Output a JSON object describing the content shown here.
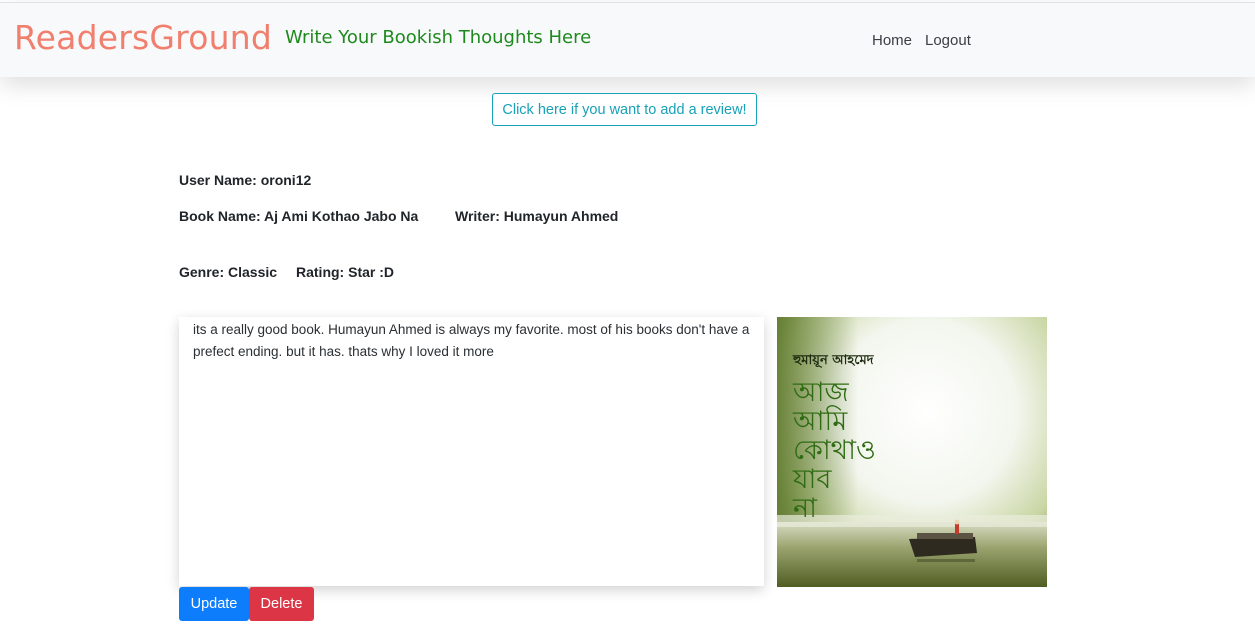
{
  "navbar": {
    "brand": "ReadersGround",
    "tagline": "Write Your Bookish Thoughts Here",
    "links": [
      "Home",
      "Logout"
    ]
  },
  "add_review_button": "Click here if you want to add a review!",
  "review": {
    "user_name": "User Name: oroni12",
    "book_name": "Book Name: Aj Ami Kothao Jabo Na",
    "writer": "Writer: Humayun Ahmed",
    "genre": "Genre: Classic",
    "rating": "Rating: Star :D",
    "text": "its a really good book. Humayun Ahmed is always my favorite. most of his books don't have a prefect ending. but it has. thats why I loved it more"
  },
  "cover": {
    "author_text": "হুমায়ূন আহমেদ",
    "title_lines": [
      "আজ",
      "আমি",
      "কোথাও",
      "যাব",
      "না"
    ]
  },
  "actions": {
    "update": "Update",
    "delete": "Delete"
  },
  "colors": {
    "brand": "#f07f6e",
    "tagline": "#1e8a1e",
    "outline_info": "#17a2b8",
    "primary": "#0d7dfb",
    "danger": "#dc3545"
  }
}
